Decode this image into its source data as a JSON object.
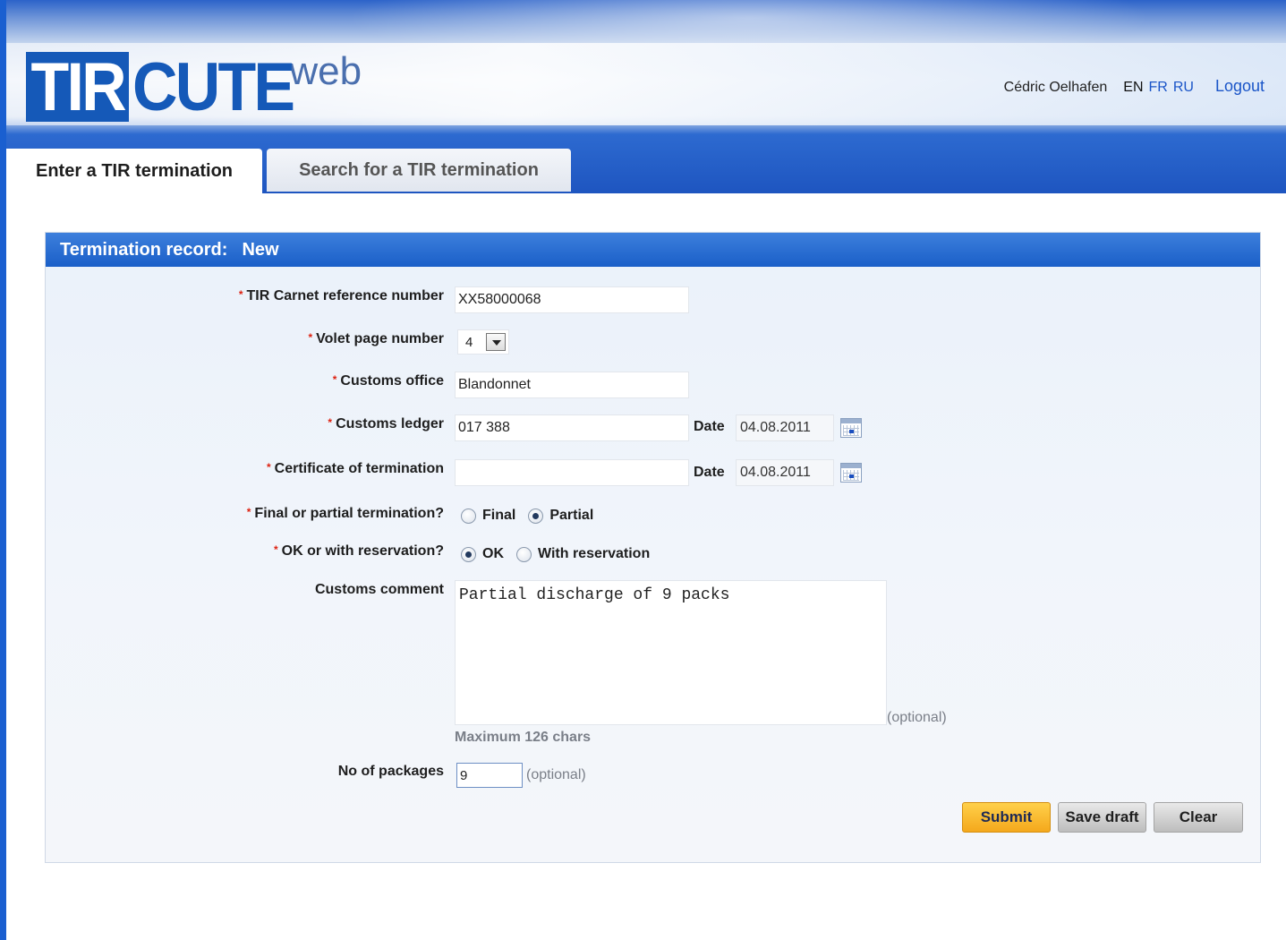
{
  "header": {
    "logo": {
      "part1": "TIR",
      "part2": "CUTE",
      "part3": "web"
    },
    "user_name": "Cédric Oelhafen",
    "languages": [
      "EN",
      "FR",
      "RU"
    ],
    "active_language": "EN",
    "logout_label": "Logout"
  },
  "tabs": [
    {
      "label": "Enter a TIR termination",
      "active": true
    },
    {
      "label": "Search for a TIR termination",
      "active": false
    }
  ],
  "panel": {
    "title": "Termination record:",
    "status": "New"
  },
  "form": {
    "carnet_ref": {
      "label": "TIR Carnet reference number",
      "required": true,
      "value": "XX58000068"
    },
    "volet_page": {
      "label": "Volet page number",
      "required": true,
      "value": "4"
    },
    "customs_office": {
      "label": "Customs office",
      "required": true,
      "value": "Blandonnet"
    },
    "customs_ledger": {
      "label": "Customs ledger",
      "required": true,
      "value": "017 388",
      "date_label": "Date",
      "date_value": "04.08.2011"
    },
    "certificate": {
      "label": "Certificate of termination",
      "required": true,
      "value": "",
      "date_label": "Date",
      "date_value": "04.08.2011"
    },
    "final_partial": {
      "label": "Final or partial termination?",
      "required": true,
      "options": [
        "Final",
        "Partial"
      ],
      "selected": "Partial"
    },
    "ok_reservation": {
      "label": "OK or with reservation?",
      "required": true,
      "options": [
        "OK",
        "With reservation"
      ],
      "selected": "OK"
    },
    "customs_comment": {
      "label": "Customs comment",
      "value": "Partial discharge of 9 packs",
      "optional_note": "(optional)",
      "hint": "Maximum 126 chars"
    },
    "packages": {
      "label": "No of packages",
      "value": "9",
      "optional_note": "(optional)"
    }
  },
  "buttons": {
    "submit": "Submit",
    "save_draft": "Save draft",
    "clear": "Clear"
  },
  "colors": {
    "accent_blue": "#1a5fc8",
    "submit_orange": "#f4a81c",
    "required_red": "#d21111"
  }
}
